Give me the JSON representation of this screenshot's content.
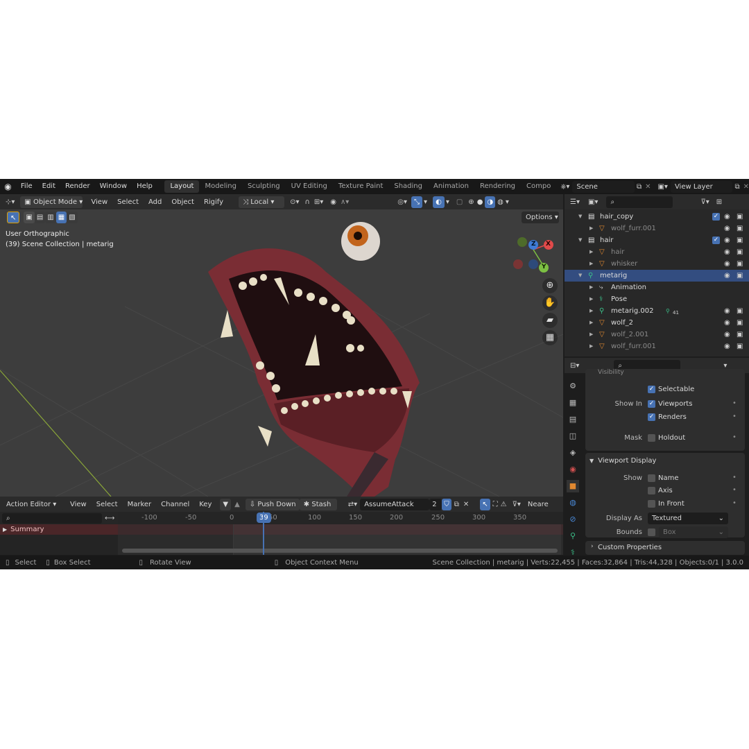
{
  "menu": [
    "File",
    "Edit",
    "Render",
    "Window",
    "Help"
  ],
  "workspaces": [
    "Layout",
    "Modeling",
    "Sculpting",
    "UV Editing",
    "Texture Paint",
    "Shading",
    "Animation",
    "Rendering",
    "Compo"
  ],
  "scene": "Scene",
  "view_layer": "View Layer",
  "viewport_header": {
    "mode": "Object Mode",
    "menus": [
      "View",
      "Select",
      "Add",
      "Object",
      "Rigify"
    ],
    "orientation": "Local",
    "options": "Options"
  },
  "viewport": {
    "view_name": "User Orthographic",
    "collection_info": "(39) Scene Collection | metarig",
    "gizmo": {
      "x": "X",
      "y": "Y",
      "z": "Z"
    }
  },
  "outliner": {
    "rows": [
      {
        "label": "hair_copy",
        "indent": 0,
        "type": "collection"
      },
      {
        "label": "wolf_furr.001",
        "indent": 1,
        "type": "mesh",
        "dim": true
      },
      {
        "label": "hair",
        "indent": 0,
        "type": "collection"
      },
      {
        "label": "hair",
        "indent": 1,
        "type": "mesh",
        "dim": true
      },
      {
        "label": "whisker",
        "indent": 1,
        "type": "mesh",
        "dim": true
      },
      {
        "label": "metarig",
        "indent": 0,
        "type": "armature",
        "selected": true
      },
      {
        "label": "Animation",
        "indent": 1,
        "type": "anim"
      },
      {
        "label": "Pose",
        "indent": 1,
        "type": "pose"
      },
      {
        "label": "metarig.002",
        "indent": 1,
        "type": "armature",
        "badge": "41"
      },
      {
        "label": "wolf_2",
        "indent": 1,
        "type": "mesh"
      },
      {
        "label": "wolf_2.001",
        "indent": 1,
        "type": "mesh",
        "dim": true
      },
      {
        "label": "wolf_furr.001",
        "indent": 1,
        "type": "mesh",
        "dim": true
      }
    ]
  },
  "properties": {
    "section_visibility": "Visibility",
    "selectable": "Selectable",
    "show_in_label": "Show In",
    "viewports": "Viewports",
    "renders": "Renders",
    "mask_label": "Mask",
    "holdout": "Holdout",
    "viewport_display": "Viewport Display",
    "show_label": "Show",
    "name": "Name",
    "axis": "Axis",
    "in_front": "In Front",
    "display_as_label": "Display As",
    "display_as_value": "Textured",
    "bounds_label": "Bounds",
    "bounds_value": "Box",
    "custom_properties": "Custom Properties"
  },
  "action_editor": {
    "mode": "Action Editor",
    "menus": [
      "View",
      "Select",
      "Marker",
      "Channel",
      "Key"
    ],
    "push_down": "Push Down",
    "stash": "Stash",
    "action_name": "AssumeAttack",
    "users": "2",
    "snapping": "Neare",
    "current_frame": "39",
    "ruler": [
      "-100",
      "-50",
      "0",
      "50",
      "100",
      "150",
      "200",
      "250",
      "300",
      "350"
    ],
    "channel": "Summary"
  },
  "statusbar": {
    "select": "Select",
    "box_select": "Box Select",
    "rotate_view": "Rotate View",
    "context_menu": "Object Context Menu",
    "stats": "Scene Collection | metarig | Verts:22,455 | Faces:32,864 | Tris:44,328 | Objects:0/1 | 3.0.0"
  },
  "colors": {
    "accent": "#4772b3",
    "selection": "#334d80",
    "viewport_bg": "#3d3d3d",
    "axis_x": "#e04a4a",
    "axis_y": "#7cc043",
    "axis_z": "#3f7bd6",
    "frame_line": "#4772b3"
  }
}
